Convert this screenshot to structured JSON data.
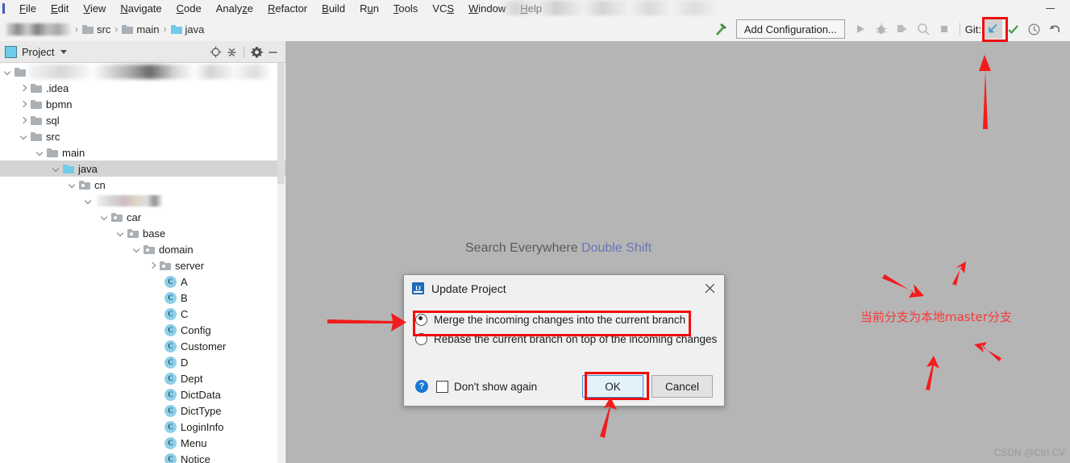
{
  "window": {
    "title_blurred": true,
    "minimize_label": "Minimize"
  },
  "menubar": {
    "items": [
      {
        "label": "File",
        "mnemonic": "F"
      },
      {
        "label": "Edit",
        "mnemonic": "E"
      },
      {
        "label": "View",
        "mnemonic": "V"
      },
      {
        "label": "Navigate",
        "mnemonic": "N"
      },
      {
        "label": "Code",
        "mnemonic": "C"
      },
      {
        "label": "Analyze",
        "mnemonic": "z"
      },
      {
        "label": "Refactor",
        "mnemonic": "R"
      },
      {
        "label": "Build",
        "mnemonic": "B"
      },
      {
        "label": "Run",
        "mnemonic": "u"
      },
      {
        "label": "Tools",
        "mnemonic": "T"
      },
      {
        "label": "VCS",
        "mnemonic": "S"
      },
      {
        "label": "Window",
        "mnemonic": "W"
      },
      {
        "label": "Help",
        "mnemonic": "H"
      }
    ]
  },
  "navbar": {
    "crumbs": [
      "src",
      "main",
      "java"
    ],
    "separator": "›",
    "project_name_blurred": true
  },
  "toolbar": {
    "add_configuration_label": "Add Configuration...",
    "git_label": "Git:",
    "update_project_tooltip": "Update Project",
    "commit_tooltip": "Commit",
    "history_tooltip": "Show History",
    "revert_tooltip": "Rollback",
    "highlight_color": "#f00d0d"
  },
  "project_panel": {
    "title": "Project",
    "icons": [
      "locate-icon",
      "collapse-all-icon",
      "settings-icon",
      "hide-icon"
    ],
    "tree": [
      {
        "depth": 0,
        "label": "",
        "type": "root-blur",
        "toggle": "open"
      },
      {
        "depth": 1,
        "label": ".idea",
        "type": "folder",
        "toggle": "closed"
      },
      {
        "depth": 1,
        "label": "bpmn",
        "type": "folder",
        "toggle": "closed"
      },
      {
        "depth": 1,
        "label": "sql",
        "type": "folder",
        "toggle": "closed"
      },
      {
        "depth": 1,
        "label": "src",
        "type": "folder",
        "toggle": "open"
      },
      {
        "depth": 2,
        "label": "main",
        "type": "folder",
        "toggle": "open"
      },
      {
        "depth": 3,
        "label": "java",
        "type": "source-folder",
        "toggle": "open",
        "selected": true
      },
      {
        "depth": 4,
        "label": "cn",
        "type": "package",
        "toggle": "open"
      },
      {
        "depth": 5,
        "label": "",
        "type": "package-blur",
        "toggle": "open"
      },
      {
        "depth": 6,
        "label": "car",
        "type": "package",
        "toggle": "open"
      },
      {
        "depth": 7,
        "label": "base",
        "type": "package",
        "toggle": "open"
      },
      {
        "depth": 8,
        "label": "domain",
        "type": "package",
        "toggle": "open"
      },
      {
        "depth": 9,
        "label": "server",
        "type": "package",
        "toggle": "closed"
      },
      {
        "depth": 9,
        "label": "A",
        "type": "class"
      },
      {
        "depth": 9,
        "label": "B",
        "type": "class"
      },
      {
        "depth": 9,
        "label": "C",
        "type": "class"
      },
      {
        "depth": 9,
        "label": "Config",
        "type": "class"
      },
      {
        "depth": 9,
        "label": "Customer",
        "type": "class"
      },
      {
        "depth": 9,
        "label": "D",
        "type": "class"
      },
      {
        "depth": 9,
        "label": "Dept",
        "type": "class"
      },
      {
        "depth": 9,
        "label": "DictData",
        "type": "class"
      },
      {
        "depth": 9,
        "label": "DictType",
        "type": "class"
      },
      {
        "depth": 9,
        "label": "LoginInfo",
        "type": "class"
      },
      {
        "depth": 9,
        "label": "Menu",
        "type": "class"
      },
      {
        "depth": 9,
        "label": "Notice",
        "type": "class"
      }
    ],
    "class_icon_letter": "C"
  },
  "editor": {
    "search_everywhere_label": "Search Everywhere",
    "search_everywhere_shortcut": "Double Shift",
    "watermark": "CSDN @Ctrl CV",
    "annotation_cn": "当前分支为本地master分支"
  },
  "dialog": {
    "title": "Update Project",
    "close_label": "×",
    "options": [
      {
        "label": "Merge the incoming changes into the current branch",
        "selected": true,
        "highlighted": true
      },
      {
        "label": "Rebase the current branch on top of the incoming changes",
        "selected": false,
        "highlighted": false
      }
    ],
    "help_label": "?",
    "dont_show_again_label": "Don't show again",
    "dont_show_again_checked": false,
    "ok_label": "OK",
    "cancel_label": "Cancel",
    "ok_is_default": true,
    "ok_highlighted": true
  },
  "annotations": {
    "color": "#f33a3a",
    "arrow_count": 7,
    "highlight_boxes": [
      "update-project-toolbar-button",
      "merge-radio-option",
      "ok-button"
    ]
  }
}
